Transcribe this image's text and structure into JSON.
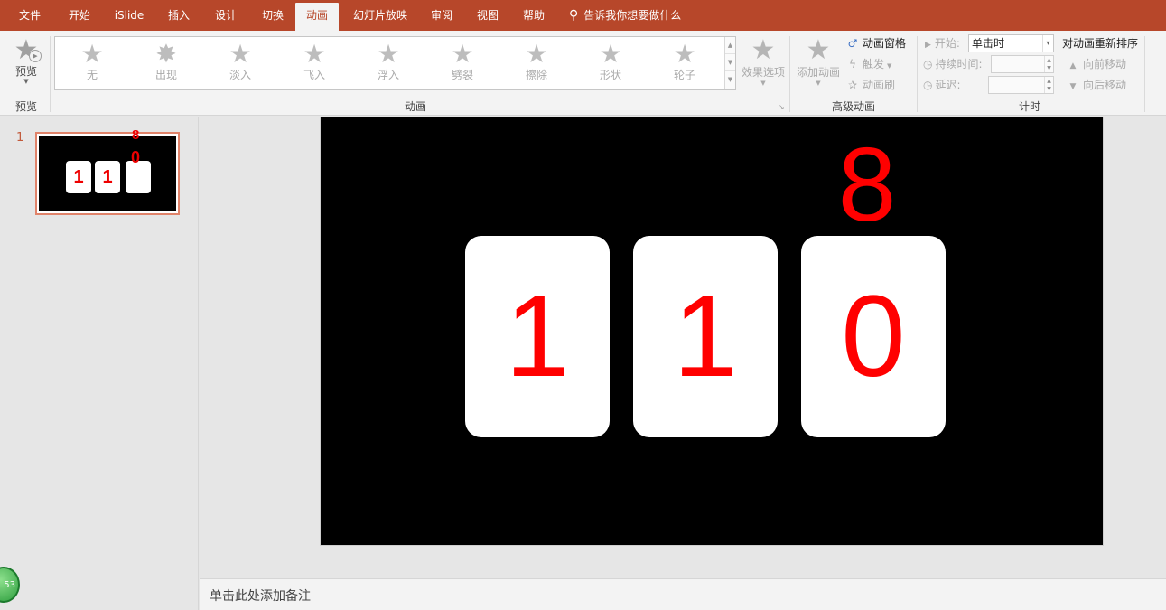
{
  "menu": {
    "tabs": [
      "文件",
      "开始",
      "iSlide",
      "插入",
      "设计",
      "切换",
      "动画",
      "幻灯片放映",
      "审阅",
      "视图",
      "帮助"
    ],
    "active_tab": "动画",
    "tellme": "告诉我你想要做什么"
  },
  "ribbon": {
    "preview": {
      "label": "预览",
      "group": "预览"
    },
    "animation_gallery": {
      "items": [
        "无",
        "出现",
        "淡入",
        "飞入",
        "浮入",
        "劈裂",
        "擦除",
        "形状",
        "轮子"
      ],
      "group": "动画"
    },
    "effect_options": "效果选项",
    "advanced": {
      "add_animation": "添加动画",
      "animation_pane": "动画窗格",
      "trigger": "触发",
      "painter": "动画刷",
      "group": "高级动画"
    },
    "timing": {
      "start_label": "开始:",
      "start_value": "单击时",
      "duration_label": "持续时间:",
      "delay_label": "延迟:",
      "reorder_title": "对动画重新排序",
      "move_earlier": "向前移动",
      "move_later": "向后移动",
      "group": "计时"
    }
  },
  "thumbnails": {
    "slide_number": "1",
    "cards": [
      "1",
      "1",
      ""
    ],
    "over_top": "8",
    "over_bottom": "0"
  },
  "timer_badge": "53",
  "slide": {
    "cards": [
      "1",
      "1",
      "0"
    ],
    "overlay_digit": "8"
  },
  "notes_placeholder": "单击此处添加备注",
  "colors": {
    "menu_bar": "#b7472a",
    "digit_red": "#ff0000",
    "slide_bg": "#000000",
    "card_bg": "#ffffff"
  }
}
